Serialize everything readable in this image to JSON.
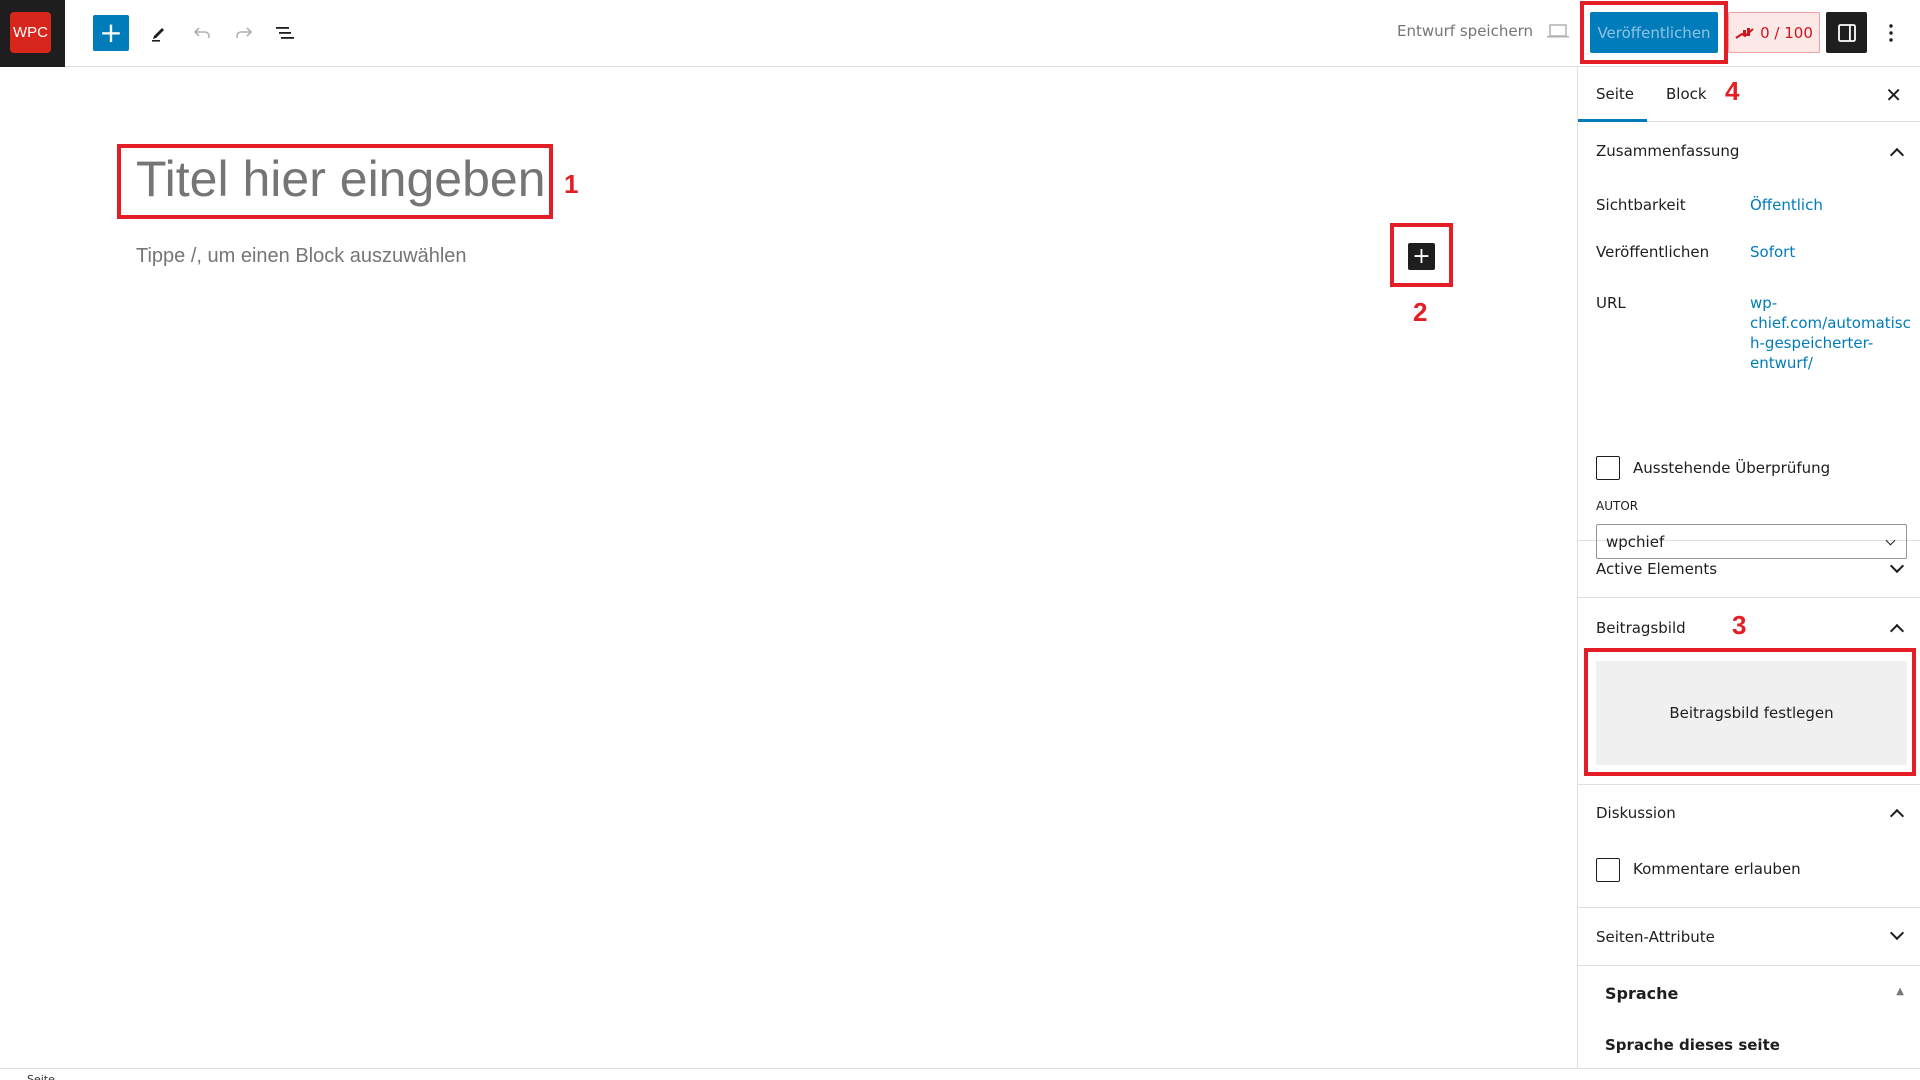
{
  "header": {
    "logo_text": "WPC",
    "icons": [
      "plus-icon",
      "pencil-icon",
      "undo-icon",
      "redo-icon",
      "list-view-icon",
      "laptop-icon",
      "chart-icon",
      "sidebar-icon",
      "more-vertical-icon"
    ],
    "save_draft": "Entwurf speichern",
    "publish": "Veröffentlichen",
    "score": "0 / 100"
  },
  "editor": {
    "title_placeholder": "Titel hier eingeben",
    "block_placeholder": "Tippe /, um einen Block auszuwählen"
  },
  "annotations": [
    "1",
    "2",
    "3",
    "4"
  ],
  "annotation_color": "#e41e26",
  "sidebar": {
    "tabs": [
      "Seite",
      "Block"
    ],
    "active_tab": "Seite",
    "summary": {
      "title": "Zusammenfassung",
      "visibility_label": "Sichtbarkeit",
      "visibility_value": "Öffentlich",
      "publish_label": "Veröffentlichen",
      "publish_value": "Sofort",
      "url_label": "URL",
      "url_lines": [
        "wp-",
        "chief.com/automatisc",
        "h-gespeicherter-",
        "entwurf/"
      ],
      "pending_review": "Ausstehende Überprüfung",
      "author_label": "AUTOR",
      "author_value": "wpchief"
    },
    "active_elements": "Active Elements",
    "featured_image": {
      "title": "Beitragsbild",
      "button": "Beitragsbild festlegen"
    },
    "discussion": {
      "title": "Diskussion",
      "allow_comments": "Kommentare erlauben"
    },
    "page_attributes": "Seiten-Attribute",
    "language": {
      "title": "Sprache",
      "subtitle": "Sprache dieses seite"
    }
  },
  "colors": {
    "accent": "#007cba",
    "score_red": "#d0141c"
  }
}
